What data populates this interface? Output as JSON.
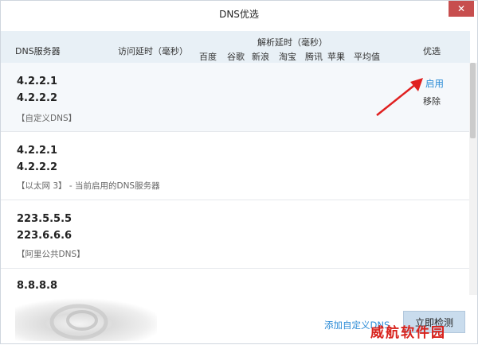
{
  "window": {
    "title": "DNS优选",
    "close_glyph": "✕"
  },
  "header": {
    "server": "DNS服务器",
    "latency": "访问延时（毫秒）",
    "resolve": "解析延时（毫秒）",
    "sites": [
      "百度",
      "谷歌",
      "新浪",
      "淘宝",
      "腾讯",
      "苹果",
      "平均值"
    ],
    "optimize": "优选"
  },
  "rows": [
    {
      "ips": [
        "4.2.2.1",
        "4.2.2.2"
      ],
      "tag": "【自定义DNS】",
      "action": "启用",
      "remove": "移除"
    },
    {
      "ips": [
        "4.2.2.1",
        "4.2.2.2"
      ],
      "tag": "【以太网 3】 - 当前启用的DNS服务器"
    },
    {
      "ips": [
        "223.5.5.5",
        "223.6.6.6"
      ],
      "tag": "【阿里公共DNS】"
    },
    {
      "ips": [
        "8.8.8.8"
      ]
    }
  ],
  "footer": {
    "add_custom": "添加自定义DNS",
    "check_now": "立即检测"
  },
  "watermark": "威航软件园",
  "colors": {
    "accent": "#2b8bd6",
    "close": "#c74e4e",
    "header_bg": "#e8f0f6",
    "annotation_arrow": "#e02020",
    "watermark": "#d8231d"
  }
}
